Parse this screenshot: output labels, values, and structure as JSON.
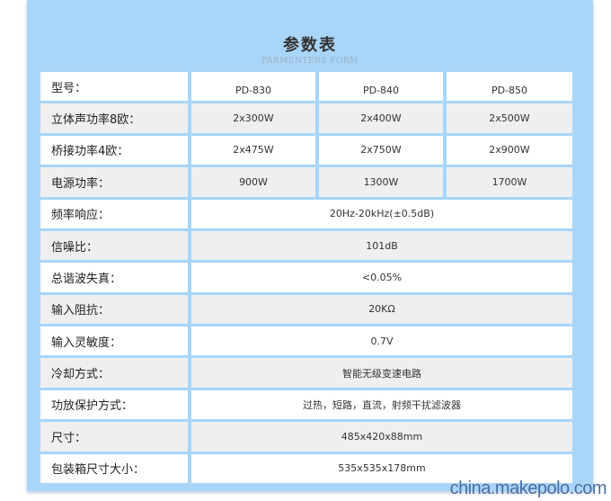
{
  "title": "参数表",
  "subtitle": "PARMENTERS FORM",
  "models": {
    "label": "型号：",
    "names": [
      "PD-830",
      "PD-840",
      "PD-850"
    ]
  },
  "per_model_rows": [
    {
      "label": "立体声功率8欧：",
      "values": [
        "2x300W",
        "2x400W",
        "2x500W"
      ]
    },
    {
      "label": "桥接功率4欧：",
      "values": [
        "2x475W",
        "2x750W",
        "2x900W"
      ]
    },
    {
      "label": "电源功率：",
      "values": [
        "900W",
        "1300W",
        "1700W"
      ]
    }
  ],
  "shared_rows": [
    {
      "label": "频率响应：",
      "value": "20Hz-20kHz(±0.5dB)"
    },
    {
      "label": "信噪比：",
      "value": "101dB"
    },
    {
      "label": "总谐波失真：",
      "value": "<0.05%"
    },
    {
      "label": "输入阻抗：",
      "value": "20KΩ"
    },
    {
      "label": "输入灵敏度：",
      "value": "0.7V"
    },
    {
      "label": "冷却方式：",
      "value": "智能无级变速电路"
    },
    {
      "label": "功放保护方式：",
      "value": "过热，短路，直流，射频干扰滤波器"
    },
    {
      "label": "尺寸：",
      "value": "485x420x88mm"
    },
    {
      "label": "包装箱尺寸大小：",
      "value": "535x535x178mm"
    }
  ],
  "watermark": "china.makepolo.com",
  "colors": {
    "panel": "#a9d5f8",
    "row_white": "#ffffff",
    "row_gray": "#efefef",
    "text": "#333333"
  }
}
